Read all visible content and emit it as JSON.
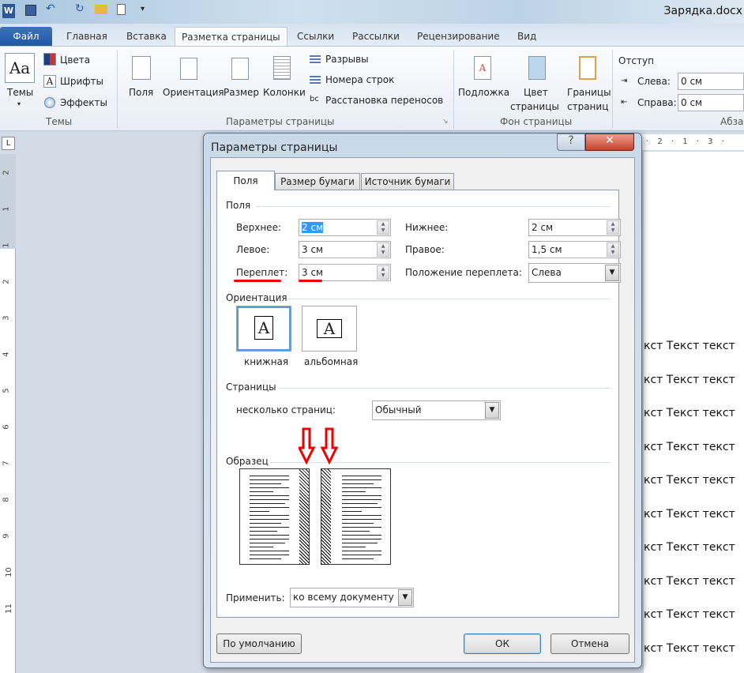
{
  "window": {
    "title": "Зарядка.docx"
  },
  "tabs": [
    "Файл",
    "Главная",
    "Вставка",
    "Разметка страницы",
    "Ссылки",
    "Рассылки",
    "Рецензирование",
    "Вид"
  ],
  "ribbon": {
    "themes": {
      "themes": "Темы",
      "colors": "Цвета",
      "fonts": "Шрифты",
      "effects": "Эффекты",
      "group": "Темы"
    },
    "page_setup": {
      "margins": "Поля",
      "orientation": "Ориентация",
      "size": "Размер",
      "columns": "Колонки",
      "breaks": "Разрывы",
      "line_numbers": "Номера строк",
      "hyphenation": "Расстановка переносов",
      "group": "Параметры страницы"
    },
    "background": {
      "watermark": "Подложка",
      "page_color_1": "Цвет",
      "page_color_2": "страницы",
      "borders_1": "Границы",
      "borders_2": "страниц",
      "group": "Фон страницы"
    },
    "paragraph": {
      "indent": "Отступ",
      "left_label": "Слева:",
      "left_value": "0 см",
      "right_label": "Справа:",
      "right_value": "0 см",
      "group": "Абза"
    }
  },
  "ruler": {
    "vertical": [
      "2",
      "1",
      "1",
      "2",
      "3",
      "4",
      "5",
      "6",
      "7",
      "8",
      "9",
      "10",
      "11"
    ],
    "top": "· 2 · 1 · 3 ·"
  },
  "document": {
    "line": "кст Текст текст",
    "lines": 10
  },
  "dialog": {
    "title": "Параметры страницы",
    "help": "?",
    "close": "✕",
    "tabs": [
      "Поля",
      "Размер бумаги",
      "Источник бумаги"
    ],
    "margins_section": "Поля",
    "top_label": "Верхнее:",
    "top_value": "2 см",
    "left_label": "Левое:",
    "left_value": "3 см",
    "gutter_label": "Переплет:",
    "gutter_value": "3 см",
    "bottom_label": "Нижнее:",
    "bottom_value": "2 см",
    "right_label": "Правое:",
    "right_value": "1,5 см",
    "gutter_pos_label": "Положение переплета:",
    "gutter_pos_value": "Слева",
    "orientation_section": "Ориентация",
    "portrait": "книжная",
    "landscape": "альбомная",
    "pages_section": "Страницы",
    "multiple_label": "несколько страниц:",
    "multiple_value": "Обычный",
    "preview_section": "Образец",
    "apply_label": "Применить:",
    "apply_value": "ко всему документу",
    "default_button": "По умолчанию",
    "ok": "ОК",
    "cancel": "Отмена",
    "annotation_color": "#e00000"
  }
}
